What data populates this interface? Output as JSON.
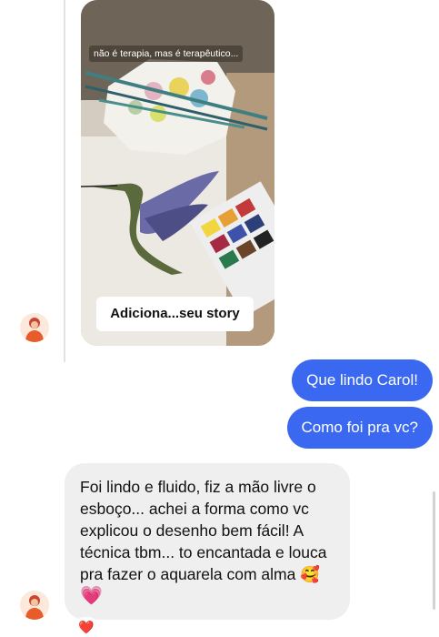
{
  "story": {
    "caption": "não é terapia, mas é terapêutico...",
    "add_story_label": "Adiciona...seu story"
  },
  "messages": {
    "outgoing": [
      {
        "text": "Que lindo Carol!"
      },
      {
        "text": "Como foi pra vc?"
      }
    ],
    "incoming": {
      "line1": "Foi lindo e fluido, fiz a mão livre o",
      "line2": "esboço... achei a forma como vc",
      "line3": "explicou o desenho bem fácil! A",
      "line4": "técnica tbm... to encantada e louca",
      "line5": "pra fazer o aquarela com alma 🥰",
      "line6": "💗"
    },
    "reaction": "❤️"
  },
  "colors": {
    "outgoing_bubble": "#3a68f0",
    "incoming_bubble": "#efeff0",
    "background": "#ffffff"
  },
  "icons": {
    "avatar": "contact-avatar-icon",
    "reaction": "red-heart-icon"
  }
}
